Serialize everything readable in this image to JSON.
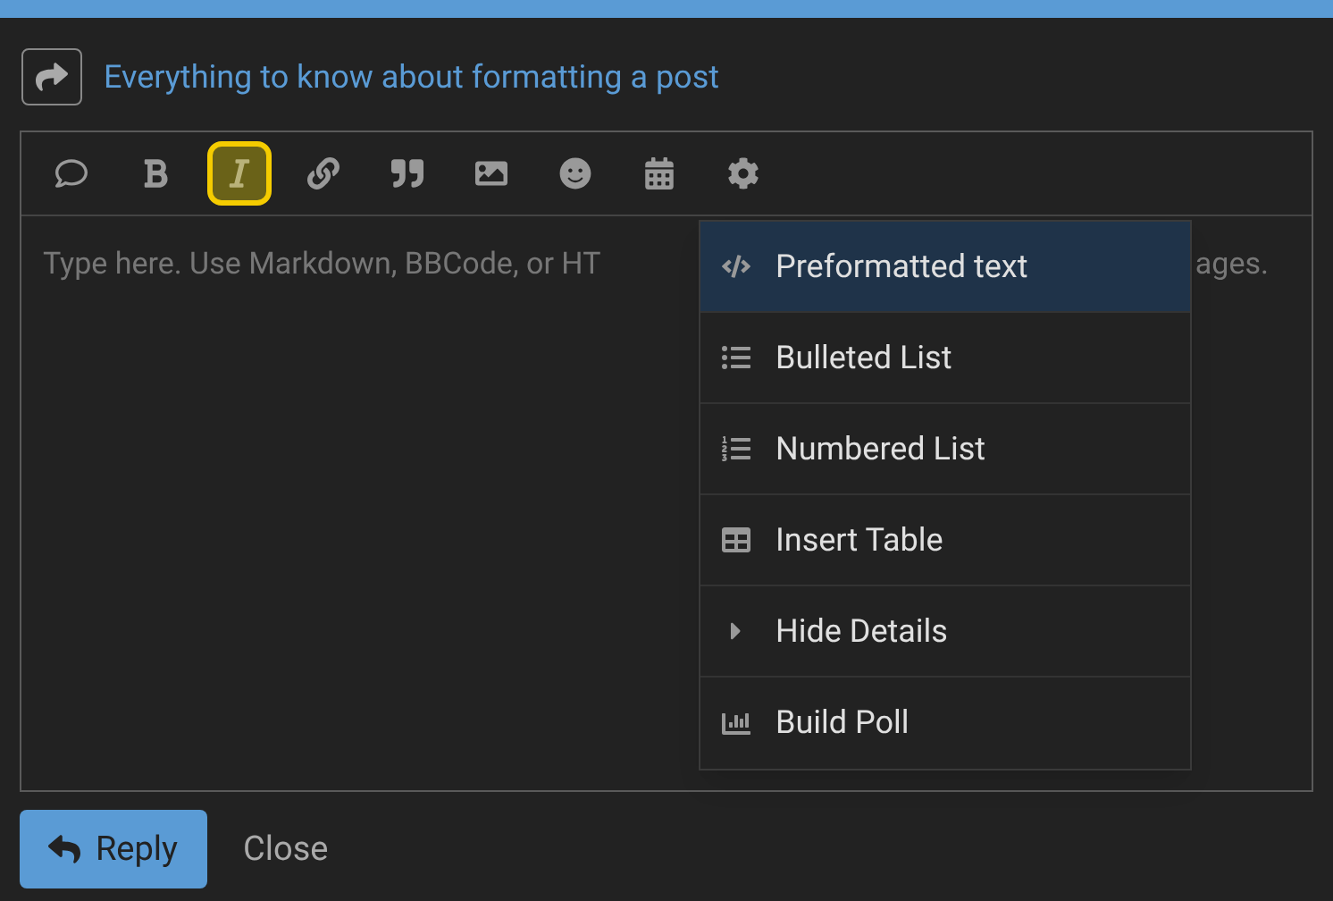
{
  "topic_link": "Everything to know about formatting a post",
  "toolbar": [
    {
      "selected": false
    },
    {
      "selected": false
    },
    {
      "selected": true
    },
    {
      "selected": false
    },
    {
      "selected": false
    },
    {
      "selected": false
    },
    {
      "selected": false
    },
    {
      "selected": false
    },
    {
      "selected": false
    }
  ],
  "editor": {
    "placeholder": "Type here. Use Markdown, BBCode, or HT",
    "placeholder_end": "ages."
  },
  "menu": [
    {
      "label": "Preformatted text",
      "selected": true
    },
    {
      "label": "Bulleted List",
      "selected": false
    },
    {
      "label": "Numbered List",
      "selected": false
    },
    {
      "label": "Insert Table",
      "selected": false
    },
    {
      "label": "Hide Details",
      "selected": false
    },
    {
      "label": "Build Poll",
      "selected": false
    }
  ],
  "buttons": {
    "reply": "Reply",
    "close": "Close"
  }
}
